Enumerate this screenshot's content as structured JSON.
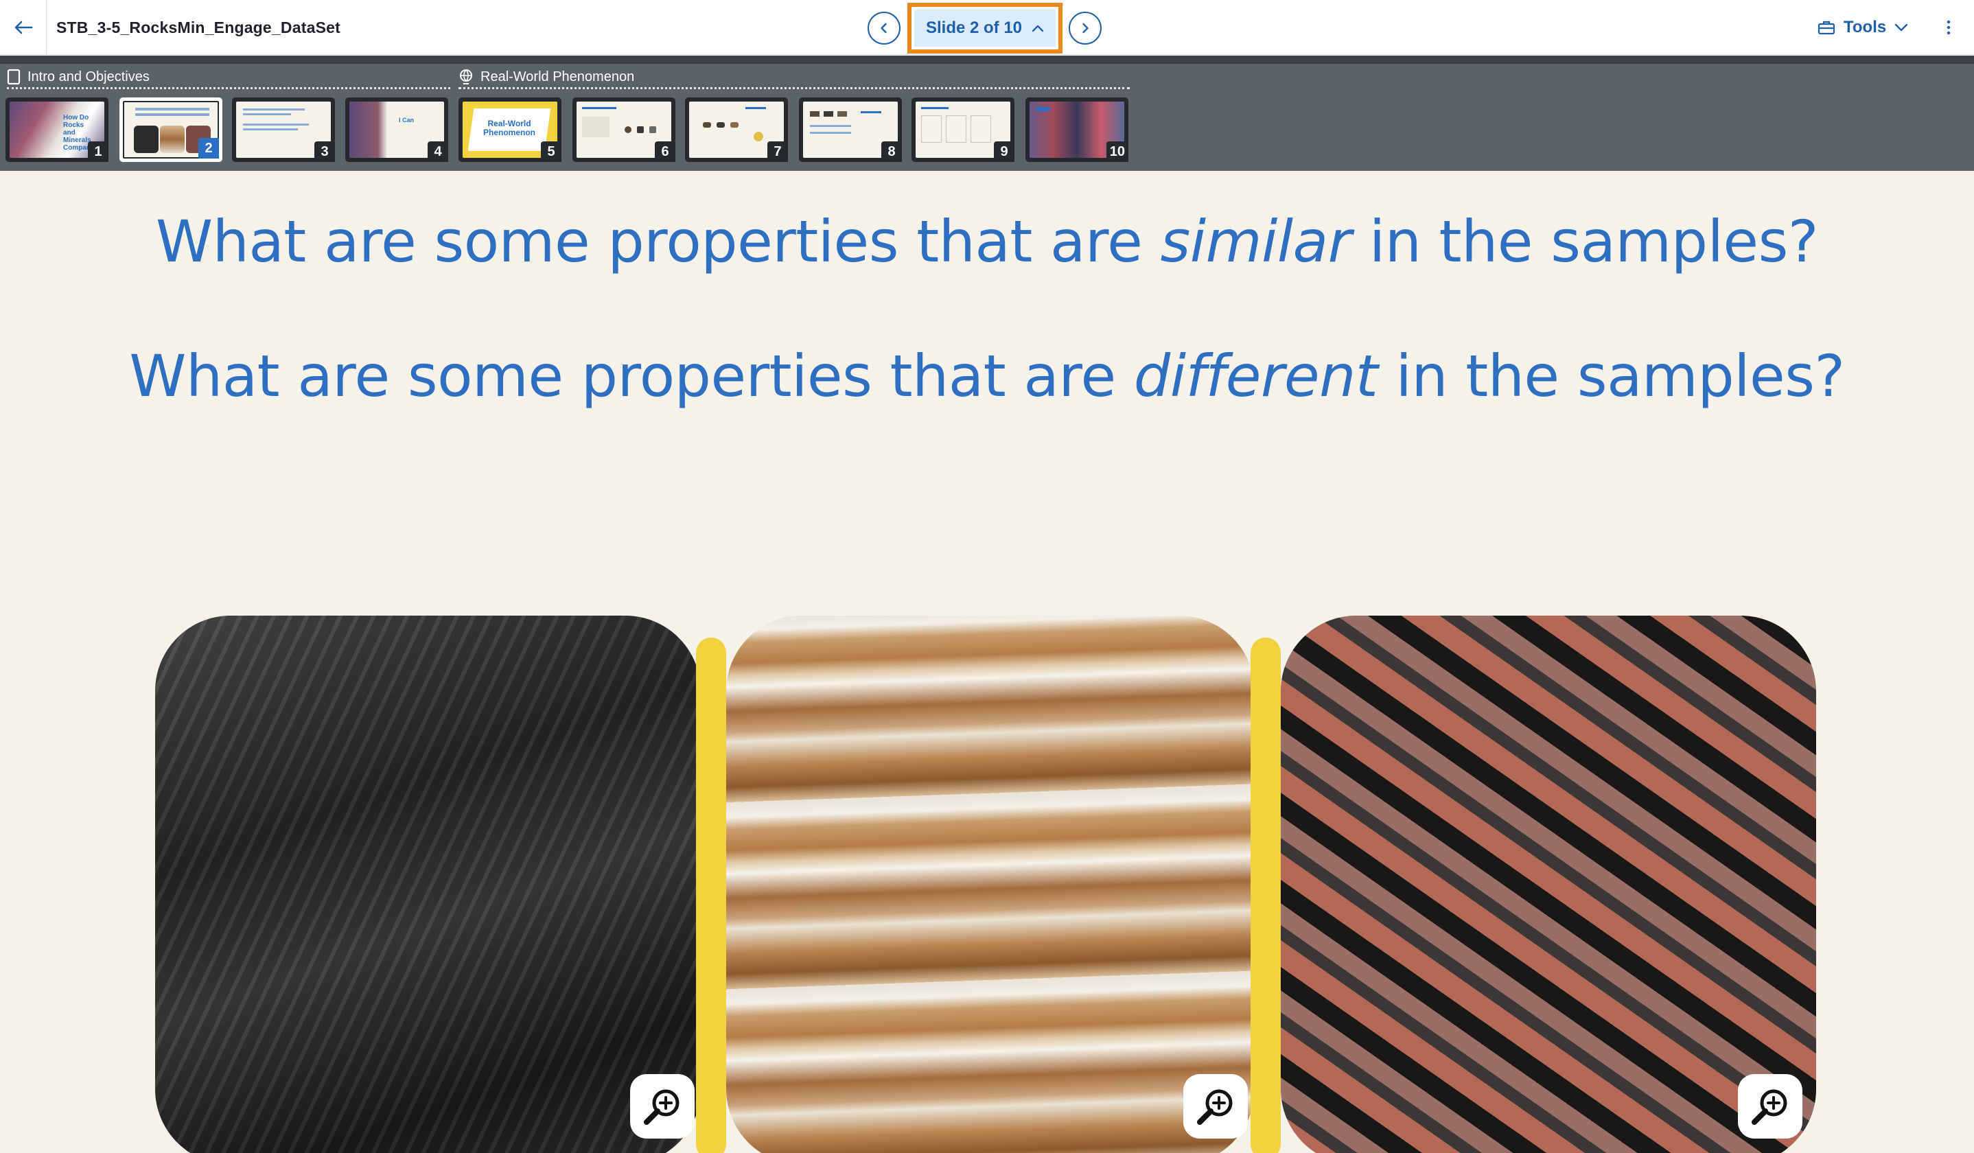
{
  "topbar": {
    "doc_title": "STB_3-5_RocksMin_Engage_DataSet",
    "slide_indicator": "Slide 2 of 10",
    "tools_label": "Tools"
  },
  "strip": {
    "sections": [
      {
        "label": "Intro and Objectives",
        "icon": "book-icon"
      },
      {
        "label": "Real-World Phenomenon",
        "icon": "globe-icon"
      }
    ],
    "thumbnails": [
      {
        "number": "1",
        "text": "How Do Rocks and Minerals Compare?"
      },
      {
        "number": "2",
        "text": "",
        "selected": true
      },
      {
        "number": "3",
        "text": ""
      },
      {
        "number": "4",
        "text": "I Can"
      },
      {
        "number": "5",
        "text": "Real-World Phenomenon"
      },
      {
        "number": "6",
        "text": ""
      },
      {
        "number": "7",
        "text": ""
      },
      {
        "number": "8",
        "text": ""
      },
      {
        "number": "9",
        "text": ""
      },
      {
        "number": "10",
        "text": ""
      }
    ]
  },
  "slide": {
    "q1_pre": "What are some properties that are ",
    "q1_em": "similar",
    "q1_post": " in the samples?",
    "q2_pre": "What are some properties that are ",
    "q2_em": "different",
    "q2_post": " in the samples?",
    "accent_color": "#f2d23f"
  },
  "colors": {
    "brand_blue": "#1e5fa8",
    "highlight_orange": "#e8891e",
    "question_blue": "#2f6fc2"
  }
}
